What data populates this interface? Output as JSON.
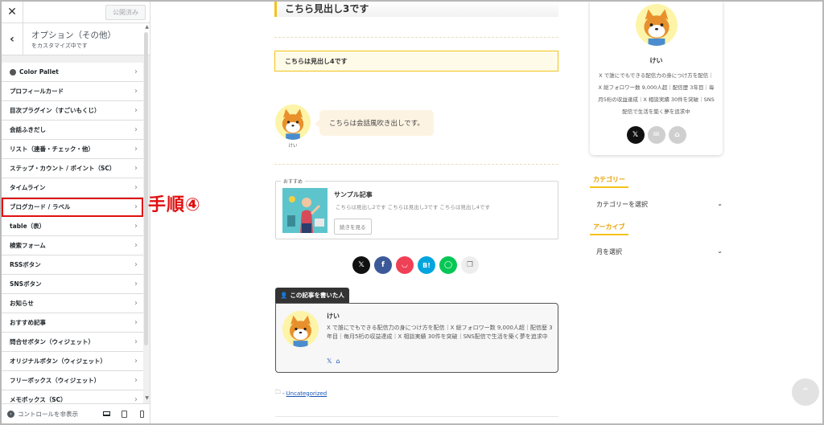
{
  "panel": {
    "publish_label": "公開済み",
    "section_title": "オプション（その他）",
    "section_sub": "をカスタマイズ中です",
    "items": [
      {
        "label": "Color Pallet"
      },
      {
        "label": "プロフィールカード"
      },
      {
        "label": "目次プラグイン（すごいもくじ）"
      },
      {
        "label": "会話ふきだし"
      },
      {
        "label": "リスト（連番・チェック・他）"
      },
      {
        "label": "ステップ・カウント / ポイント（SC）"
      },
      {
        "label": "タイムライン"
      },
      {
        "label": "ブログカード / ラベル"
      },
      {
        "label": "table（表）"
      },
      {
        "label": "検索フォーム"
      },
      {
        "label": "RSSボタン"
      },
      {
        "label": "SNSボタン"
      },
      {
        "label": "お知らせ"
      },
      {
        "label": "おすすめ記事"
      },
      {
        "label": "問合せボタン（ウィジェット）"
      },
      {
        "label": "オリジナルボタン（ウィジェット）"
      },
      {
        "label": "フリーボックス（ウィジェット）"
      },
      {
        "label": "メモボックス（SC）"
      }
    ],
    "hide_controls_label": "コントロールを非表示",
    "highlight_index": 7,
    "highlight_color": "#e01010"
  },
  "annotation": "手順④",
  "content": {
    "h3": "こちら見出し3です",
    "h4": "こちらは見出し4です",
    "bubble": {
      "name": "けい",
      "text": "こちらは会話風吹き出しです。"
    },
    "recommend": {
      "tag": "おすすめ",
      "title": "サンプル記事",
      "desc": "こちらは見出し2です こちらは見出し3です こちらは見出し4です",
      "more": "続きを見る"
    },
    "share_icons": [
      "x-icon",
      "facebook-icon",
      "pocket-icon",
      "hatena-icon",
      "line-icon",
      "copy-icon"
    ],
    "share_glyphs": {
      "x": "𝕏",
      "facebook": "f",
      "pocket": "◡",
      "hatena": "B!",
      "line": "◯",
      "copy": "❐"
    },
    "author": {
      "tab": "この記事を書いた人",
      "name": "けい",
      "desc": "X で誰にでもできる配信力の身につけ方を配信｜X 総フォロワー数 9,000人超｜配信歴 3年目｜毎月5桁の収益達成｜X 相談実績 30件を突破｜SNS配信で生活を築く夢を追求中"
    },
    "category": "Uncategorized",
    "category_prefix": "-"
  },
  "sidebar": {
    "profile": {
      "name": "けい",
      "desc": "X で誰にでもできる配信力の身につけ方を配信｜X 総フォロワー数 9,000人超｜配信歴 3年目｜毎月5桁の収益達成｜X 相談実績 30件を突破｜SNS配信で生活を築く夢を追求中"
    },
    "category_title": "カテゴリー",
    "category_select": "カテゴリーを選択",
    "archive_title": "アーカイブ",
    "archive_select": "月を選択"
  },
  "colors": {
    "accent": "#f3c319",
    "annotation": "#e01010",
    "x": "#111111",
    "facebook": "#3b5998",
    "pocket": "#ef4056",
    "hatena": "#00a4de",
    "line": "#06c755",
    "copy": "#eeeeee"
  }
}
